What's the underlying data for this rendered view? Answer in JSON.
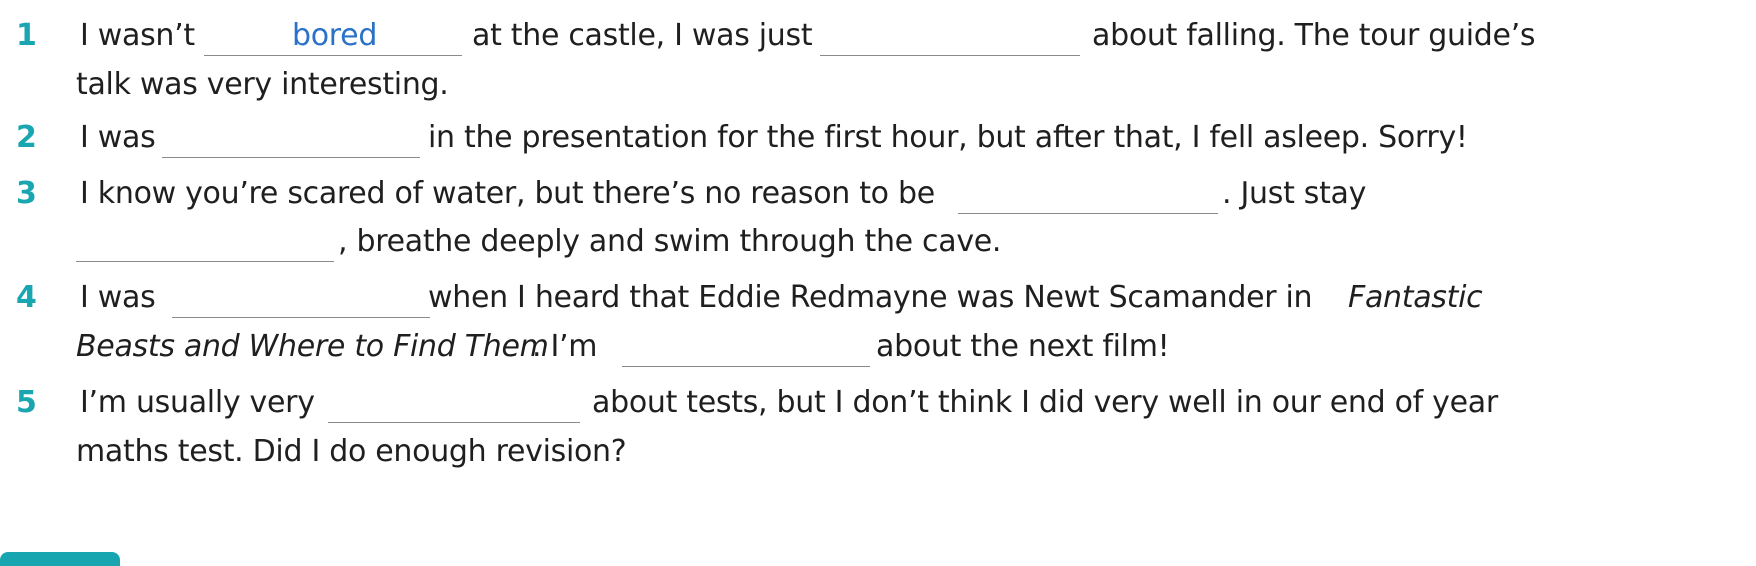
{
  "items": [
    {
      "number": "1",
      "part_a": "I wasn’t",
      "answer": "bored",
      "part_b": "at the castle, I was just",
      "part_c": "about falling. The tour guide’s",
      "line2": "talk was very interesting."
    },
    {
      "number": "2",
      "part_a": "I was",
      "part_b": "in the presentation for the first hour, but after that, I fell asleep. Sorry!"
    },
    {
      "number": "3",
      "part_a": "I know you’re scared of water, but there’s no reason to be",
      "part_b": ". Just stay",
      "line2": ", breathe deeply and swim through the cave."
    },
    {
      "number": "4",
      "part_a": "I was",
      "part_b": "when I heard that Eddie Redmayne was Newt Scamander in",
      "part_b_italic": "Fantastic",
      "line2_italic": "Beasts and Where to Find Them",
      "line2_mid": ". I’m",
      "line2_end": "about the next film!"
    },
    {
      "number": "5",
      "part_a": "I’m usually very",
      "part_b": "about tests, but I don’t think I did very well in our end of year",
      "line2": "maths test. Did I do enough revision?"
    }
  ],
  "colors": {
    "number": "#1aa6b0",
    "answer": "#2a72c8",
    "blank_line": "#8a8a8a"
  }
}
